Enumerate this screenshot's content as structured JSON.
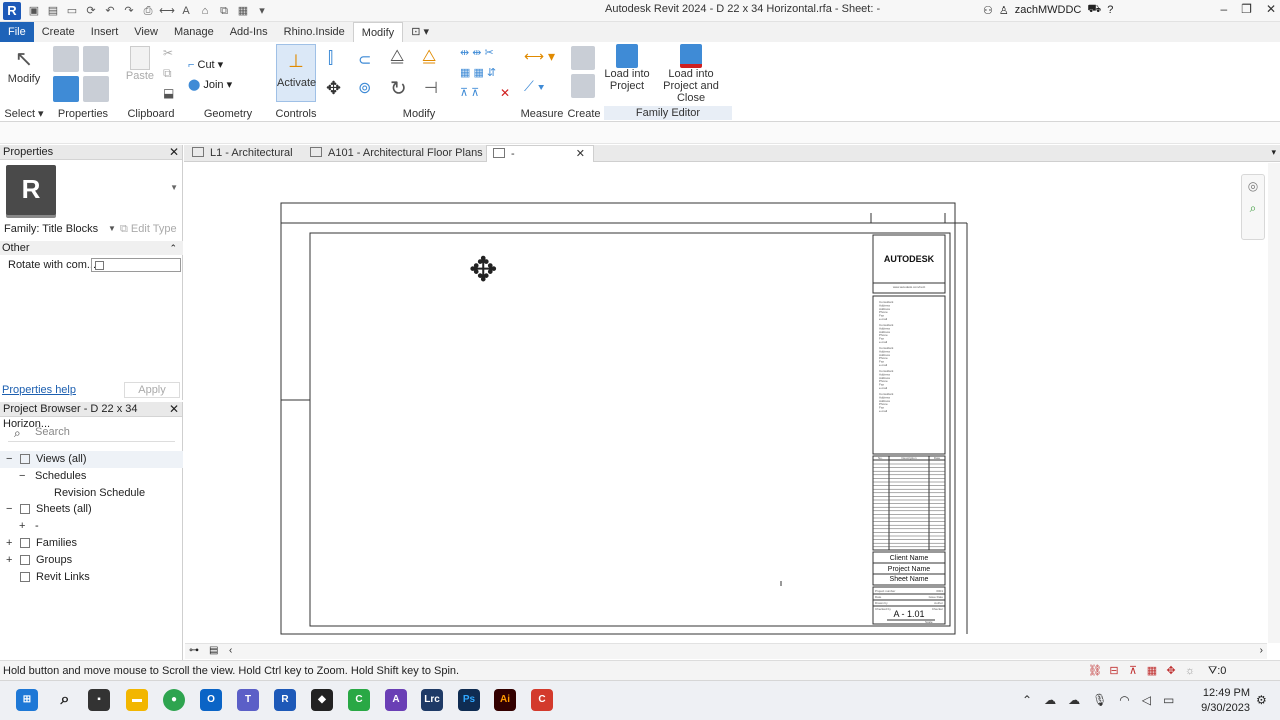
{
  "titlebar": {
    "app_letter": "R",
    "title": "Autodesk Revit 2024 - D 22 x 34 Horizontal.rfa - Sheet: -",
    "user": "zachMWDDC"
  },
  "ribbon_tabs": [
    "File",
    "Create",
    "Insert",
    "View",
    "Manage",
    "Add-Ins",
    "Rhino.Inside",
    "Modify"
  ],
  "ribbon": {
    "modify_label": "Modify",
    "select_label": "Select",
    "properties_label": "Properties",
    "paste_label": "Paste",
    "clipboard_label": "Clipboard",
    "cut_label": "Cut",
    "join_label": "Join",
    "geometry_label": "Geometry",
    "activate_label": "Activate",
    "controls_label": "Controls",
    "modify_group_label": "Modify",
    "measure_label": "Measure",
    "create_label": "Create",
    "load_project_l1": "Load into",
    "load_project_l2": "Project",
    "load_close_l1": "Load into",
    "load_close_l2": "Project and Close",
    "family_editor_label": "Family Editor"
  },
  "properties": {
    "header": "Properties",
    "type_letter": "R",
    "family": "Family: Title Blocks",
    "edit_type": "Edit Type",
    "category": "Other",
    "param_name": "Rotate with com...",
    "help": "Properties help",
    "apply": "Apply"
  },
  "browser": {
    "header": "Project Browser - D 22 x 34 Horizon...",
    "search_placeholder": "Search",
    "items": [
      {
        "label": "Views (all)",
        "pm": "−",
        "indent": 0,
        "icon": true
      },
      {
        "label": "Schedules",
        "pm": "−",
        "indent": 1,
        "icon": false
      },
      {
        "label": "Revision Schedule",
        "pm": "",
        "indent": 2,
        "icon": false
      },
      {
        "label": "Sheets (all)",
        "pm": "−",
        "indent": 0,
        "icon": true
      },
      {
        "label": "-",
        "pm": "+",
        "indent": 1,
        "icon": false
      },
      {
        "label": "Families",
        "pm": "+",
        "indent": 0,
        "icon": true
      },
      {
        "label": "Groups",
        "pm": "+",
        "indent": 0,
        "icon": true
      },
      {
        "label": "Revit Links",
        "pm": "",
        "indent": 0,
        "icon": true
      }
    ]
  },
  "view_tabs": [
    {
      "label": "L1 - Architectural"
    },
    {
      "label": "A101 - Architectural Floor Plans"
    },
    {
      "label": "-"
    }
  ],
  "titleblock": {
    "logo_text": "AUTODESK",
    "address": "www.autodesk.com/revit",
    "consultants": [
      [
        "Consultant",
        "Address",
        "Address",
        "Phone",
        "Fax",
        "e-mail"
      ],
      [
        "Consultant",
        "Address",
        "Address",
        "Phone",
        "Fax",
        "e-mail"
      ],
      [
        "Consultant",
        "Address",
        "Address",
        "Phone",
        "Fax",
        "e-mail"
      ],
      [
        "Consultant",
        "Address",
        "Address",
        "Phone",
        "Fax",
        "e-mail"
      ],
      [
        "Consultant",
        "Address",
        "Address",
        "Phone",
        "Fax",
        "e-mail"
      ]
    ],
    "rev_headers": [
      "No.",
      "Description",
      "Date"
    ],
    "client": "Client Name",
    "project": "Project Name",
    "sheet": "Sheet Name",
    "project_number_label": "Project number",
    "project_number": "0001",
    "date_label": "Date",
    "date": "Issue Date",
    "drawn_label": "Drawn by",
    "drawn": "Author",
    "checked_label": "Checked by",
    "checked": "Checker",
    "sheet_number": "A - 1.01",
    "scale_label": "Scale"
  },
  "status": {
    "message": "Hold button and move mouse to Scroll the view. Hold Ctrl key to Zoom. Hold Shift key to Spin.",
    "filter_count": ":0"
  },
  "taskbar": {
    "time": "12:49 PM",
    "date": "9/30/2023"
  },
  "colors": {
    "file_tab": "#1e63b8",
    "accent_blue": "#3f8bd6",
    "canvas_line": "#333333"
  }
}
